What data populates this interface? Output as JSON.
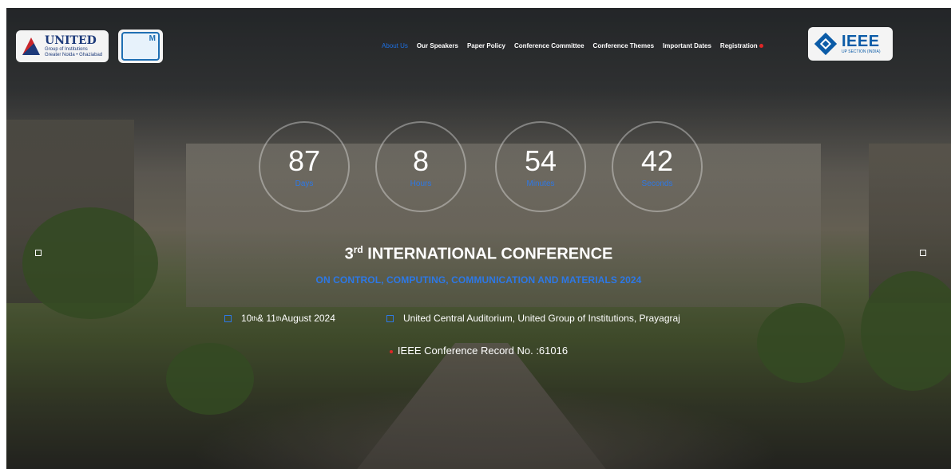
{
  "header": {
    "logos": {
      "united": {
        "name": "UNITED",
        "tagline": "Group of Institutions",
        "location": "Greater Noida • Ghaziabad"
      },
      "partner": {
        "text": "M"
      },
      "ieee": {
        "name": "IEEE",
        "tagline": "UP SECTION (INDIA)"
      }
    },
    "nav": [
      {
        "label": "About Us",
        "active": true
      },
      {
        "label": "Our Speakers"
      },
      {
        "label": "Paper Policy"
      },
      {
        "label": "Conference Committee"
      },
      {
        "label": "Conference Themes"
      },
      {
        "label": "Important Dates"
      },
      {
        "label": "Registration"
      }
    ]
  },
  "countdown": [
    {
      "value": "87",
      "label": "Days"
    },
    {
      "value": "8",
      "label": "Hours"
    },
    {
      "value": "54",
      "label": "Minutes"
    },
    {
      "value": "42",
      "label": "Seconds"
    }
  ],
  "hero": {
    "title_prefix": "3",
    "title_sup": "rd",
    "title_main": " INTERNATIONAL CONFERENCE",
    "subtitle": "ON CONTROL, COMPUTING, COMMUNICATION AND MATERIALS 2024",
    "date_d1": "10",
    "date_sup1": "th",
    "date_mid": " & 11",
    "date_sup2": "th",
    "date_end": " August 2024",
    "venue": "United Central Auditorium, United Group of Institutions, Prayagraj",
    "record": "IEEE Conference Record No. :61016"
  },
  "colors": {
    "accent": "#2d78e6",
    "alert": "#e02626",
    "text": "#ffffff"
  }
}
